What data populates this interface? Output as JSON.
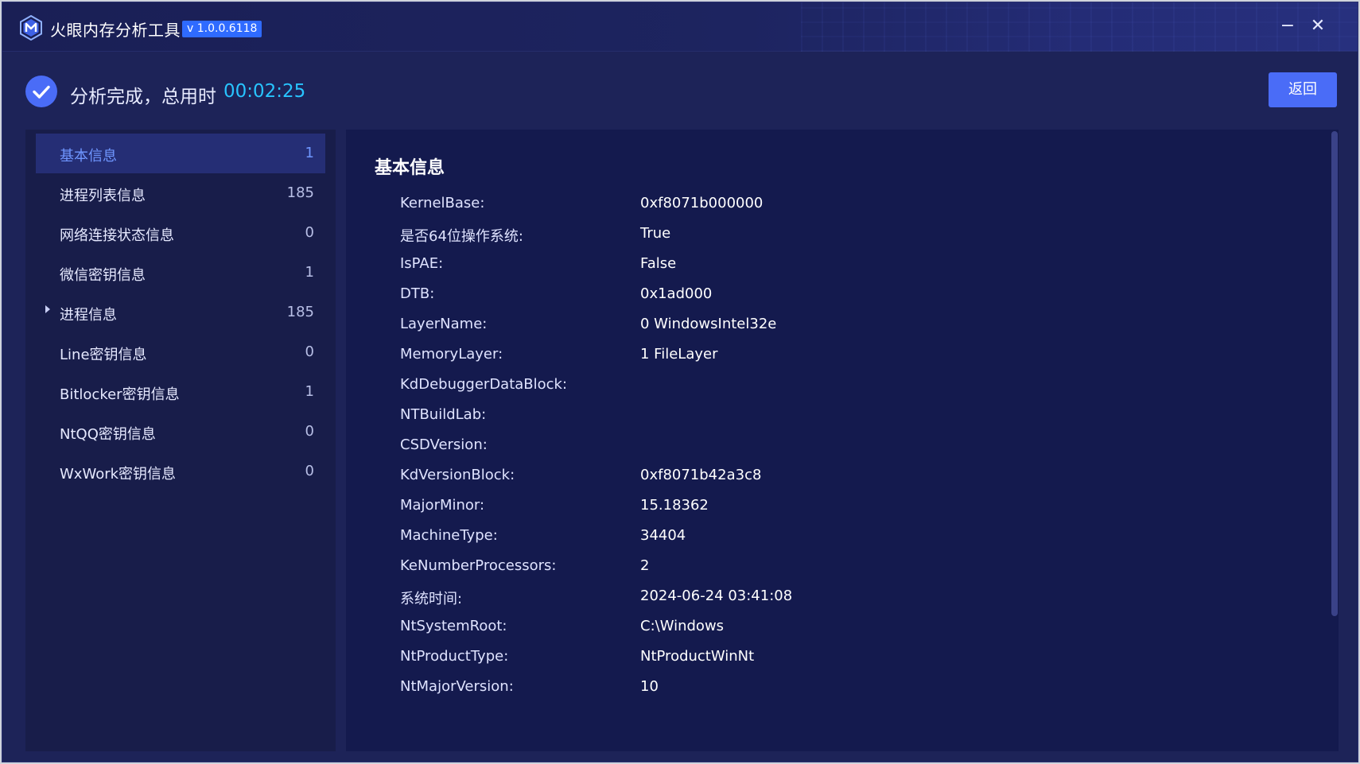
{
  "app": {
    "title": "火眼内存分析工具",
    "version": "v 1.0.0.6118"
  },
  "window_controls": {
    "minimize": "−",
    "close": "✕"
  },
  "status": {
    "message": "分析完成，总用时",
    "elapsed": "00:02:25",
    "icon": "check-circle-icon"
  },
  "back_button_label": "返回",
  "sidebar": {
    "items": [
      {
        "label": "基本信息",
        "count": "1",
        "active": true
      },
      {
        "label": "进程列表信息",
        "count": "185"
      },
      {
        "label": "网络连接状态信息",
        "count": "0"
      },
      {
        "label": "微信密钥信息",
        "count": "1"
      },
      {
        "label": "进程信息",
        "count": "185",
        "expandable": true
      },
      {
        "label": "Line密钥信息",
        "count": "0"
      },
      {
        "label": "Bitlocker密钥信息",
        "count": "1"
      },
      {
        "label": "NtQQ密钥信息",
        "count": "0"
      },
      {
        "label": "WxWork密钥信息",
        "count": "0"
      }
    ]
  },
  "main": {
    "section_title": "基本信息",
    "rows": [
      {
        "key": "KernelBase:",
        "value": "0xf8071b000000"
      },
      {
        "key": "是否64位操作系统:",
        "value": "True"
      },
      {
        "key": "IsPAE:",
        "value": "False"
      },
      {
        "key": "DTB:",
        "value": "0x1ad000"
      },
      {
        "key": "LayerName:",
        "value": "0 WindowsIntel32e"
      },
      {
        "key": "MemoryLayer:",
        "value": "1 FileLayer"
      },
      {
        "key": "KdDebuggerDataBlock:",
        "value": ""
      },
      {
        "key": "NTBuildLab:",
        "value": ""
      },
      {
        "key": "CSDVersion:",
        "value": ""
      },
      {
        "key": "KdVersionBlock:",
        "value": "0xf8071b42a3c8"
      },
      {
        "key": "MajorMinor:",
        "value": "15.18362"
      },
      {
        "key": "MachineType:",
        "value": "34404"
      },
      {
        "key": "KeNumberProcessors:",
        "value": "2"
      },
      {
        "key": "系统时间:",
        "value": "2024-06-24 03:41:08"
      },
      {
        "key": "NtSystemRoot:",
        "value": "C:\\Windows"
      },
      {
        "key": "NtProductType:",
        "value": "NtProductWinNt"
      },
      {
        "key": "NtMajorVersion:",
        "value": "10"
      }
    ]
  },
  "colors": {
    "background": "#1d2358",
    "panel": "#141a4e",
    "sidebar": "#181d4a",
    "accent": "#4a6cf7",
    "time": "#28c4ff",
    "active_label": "#6f96ff"
  }
}
